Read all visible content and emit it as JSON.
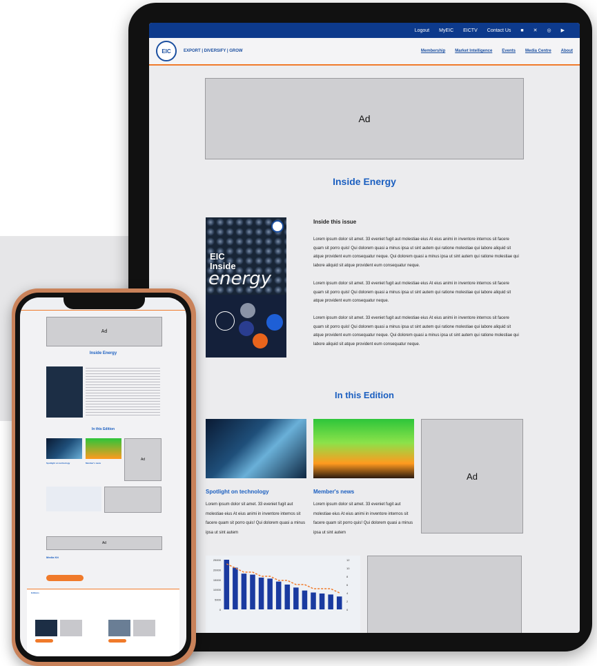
{
  "tablet": {
    "topbar": {
      "links": [
        "Logout",
        "MyEIC",
        "EICTV",
        "Contact Us"
      ],
      "social_icons": [
        "linkedin-icon",
        "x-icon",
        "instagram-icon",
        "youtube-icon"
      ]
    },
    "header": {
      "logo_text": "EIC",
      "tagline": "EXPORT | DIVERSIFY | GROW",
      "nav": [
        "Membership",
        "Market Intelligence",
        "Events",
        "Media Centre",
        "About"
      ]
    },
    "ad_label": "Ad",
    "inside_energy": {
      "title": "Inside Energy",
      "cover": {
        "line1": "EIC",
        "line2": "Inside",
        "line3": "energy"
      },
      "subtitle": "Inside this issue",
      "paragraphs": [
        "Lorem ipsum dolor sit amet. 33 eveniet fugit aut molestiae eius At eius animi in inventore internos sit facere quam sit porro quis! Qui dolorem quasi a minus ipsa ut sint autem qui ratione molestiae qui labore aliquid sit atque provident eum consequatur neque.  Qui dolorem quasi a minus ipsa ut sint autem qui ratione molestiae qui labore aliquid sit atque provident eum consequatur neque.",
        "Lorem ipsum dolor sit amet. 33 eveniet fugit aut molestiae eius At eius animi in inventore internos sit facere quam sit porro quis! Qui dolorem quasi a minus ipsa ut sint autem qui ratione molestiae qui labore aliquid sit atque provident eum consequatur neque.",
        "Lorem ipsum dolor sit amet. 33 eveniet fugit aut molestiae eius At eius animi in inventore internos sit facere quam sit porro quis! Qui dolorem quasi a minus ipsa ut sint autem qui ratione molestiae qui labore aliquid sit atque provident eum consequatur neque.  Qui dolorem quasi a minus ipsa ut sint autem qui ratione molestiae qui labore aliquid sit atque provident eum consequatur neque."
      ]
    },
    "in_this_edition": {
      "title": "In this Edition",
      "cards": [
        {
          "title": "Spotlight on technology",
          "body": "Lorem ipsum dolor sit amet. 33 eveniet fugit aut molestiae eius At eius animi in inventore internos sit facere quam sit porro quis! Qui dolorem quasi a minus ipsa ut sint autem"
        },
        {
          "title": "Member's news",
          "body": "Lorem ipsum dolor sit amet. 33 eveniet fugit aut molestiae eius At eius animi in inventore internos sit facere quam sit porro quis! Qui dolorem quasi a minus ipsa ut sint autem"
        }
      ]
    }
  },
  "phone": {
    "ad_label": "Ad",
    "inside_energy_title": "Inside Energy",
    "in_this_edition_title": "In this Edition",
    "card1_title": "Spotlight on technology",
    "card2_title": "Member's news",
    "section3_title": "Media Kit",
    "editions_label": "Editions"
  },
  "chart_data": {
    "type": "bar",
    "values": [
      25000,
      21000,
      18000,
      17500,
      16000,
      15500,
      14000,
      12500,
      11000,
      9500,
      8500,
      8000,
      7500,
      6500
    ],
    "line_values": [
      11,
      10,
      9,
      9,
      8,
      8,
      7,
      7,
      6,
      6,
      5,
      5,
      5,
      4
    ],
    "ylim": [
      0,
      25000
    ],
    "y2lim": [
      0,
      12
    ],
    "y_ticks": [
      "25000",
      "20000",
      "15000",
      "10000",
      "5000",
      "0"
    ],
    "y2_ticks": [
      "12",
      "10",
      "8",
      "6",
      "4",
      "2",
      "0"
    ],
    "colors": {
      "bars": "#1a3aa0",
      "line": "#f07a2a"
    }
  }
}
